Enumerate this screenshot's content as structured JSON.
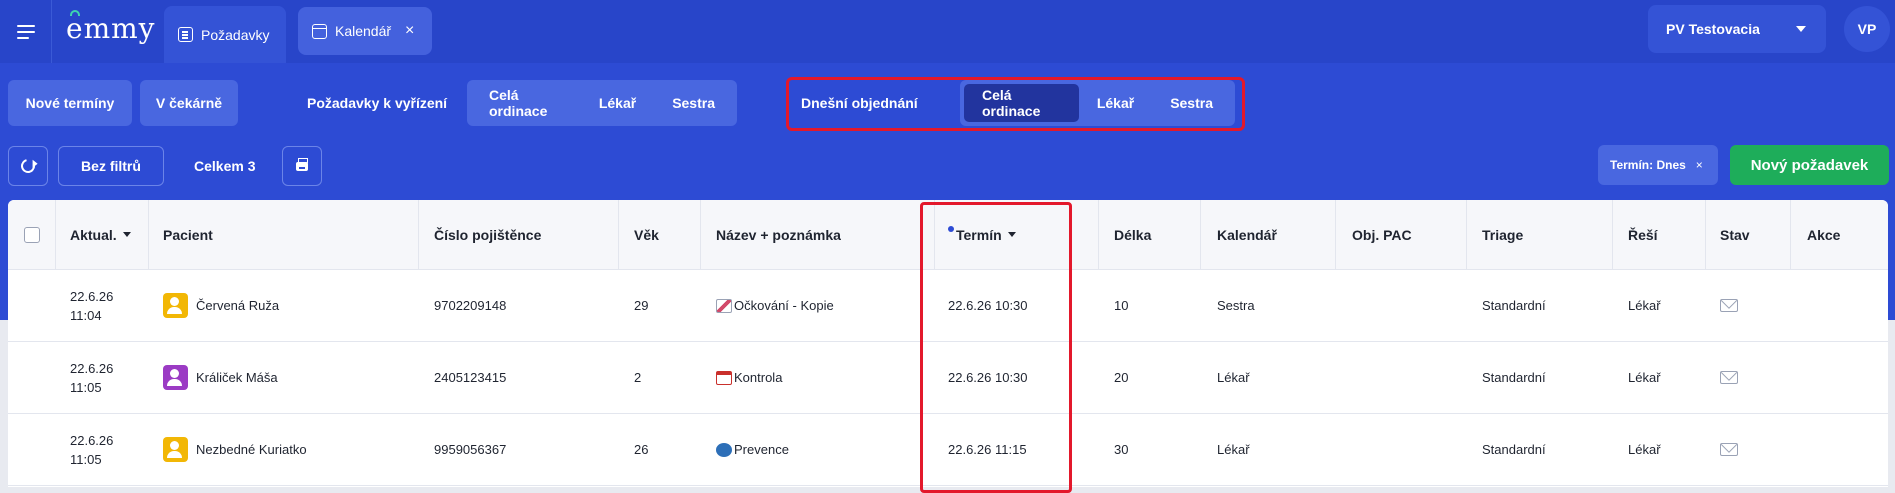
{
  "app": {
    "logo": "emmy"
  },
  "tabs": [
    {
      "label": "Požadavky",
      "icon": "document-icon",
      "active": true
    },
    {
      "label": "Kalendář",
      "icon": "calendar-icon",
      "closable": true,
      "close_glyph": "×"
    }
  ],
  "header": {
    "org_select": "PV Testovacia",
    "user_initials": "VP"
  },
  "toolbar": {
    "new_terms": "Nové termíny",
    "waiting_room": "V čekárně",
    "pending_label": "Požadavky k vyřízení",
    "pending_segments": [
      "Celá ordinace",
      "Lékař",
      "Sestra"
    ],
    "today_label": "Dnešní objednání",
    "today_segments": [
      "Celá ordinace",
      "Lékař",
      "Sestra"
    ],
    "today_active": "Celá ordinace",
    "no_filters": "Bez filtrů",
    "total": "Celkem 3",
    "filter_chip": "Termín: Dnes",
    "filter_chip_close": "×",
    "new_request": "Nový požadavek"
  },
  "table": {
    "columns": [
      "Aktual.",
      "Pacient",
      "Číslo pojištěnce",
      "Věk",
      "Název + poznámka",
      "Termín",
      "Délka",
      "Kalendář",
      "Obj. PAC",
      "Triage",
      "Řeší",
      "Stav",
      "Akce"
    ],
    "rows": [
      {
        "updated_date": "22.6.26",
        "updated_time": "11:04",
        "patient": "Červená Ruža",
        "patient_color": "#f2b705",
        "insurance": "9702209148",
        "age": "29",
        "note": "Očkování - Kopie",
        "note_icon": "vaccine-icon",
        "term": "22.6.26 10:30",
        "duration": "10",
        "calendar": "Sestra",
        "obj_pac": "",
        "triage": "Standardní",
        "handler": "Lékař",
        "status_icon": "envelope-icon"
      },
      {
        "updated_date": "22.6.26",
        "updated_time": "11:05",
        "patient": "Králiček Máša",
        "patient_color": "#9b3bc4",
        "insurance": "2405123415",
        "age": "2",
        "note": "Kontrola",
        "note_icon": "calendar-icon",
        "term": "22.6.26 10:30",
        "duration": "20",
        "calendar": "Lékař",
        "obj_pac": "",
        "triage": "Standardní",
        "handler": "Lékař",
        "status_icon": "envelope-icon"
      },
      {
        "updated_date": "22.6.26",
        "updated_time": "11:05",
        "patient": "Nezbedné Kuriatko",
        "patient_color": "#f2b705",
        "insurance": "9959056367",
        "age": "26",
        "note": "Prevence",
        "note_icon": "stethoscope-icon",
        "term": "22.6.26 11:15",
        "duration": "30",
        "calendar": "Lékař",
        "obj_pac": "",
        "triage": "Standardní",
        "handler": "Lékař",
        "status_icon": "envelope-icon"
      }
    ]
  },
  "colors": {
    "header": "#2845c9",
    "toolbar": "#2d4bd4",
    "segment": "#4967e0",
    "segment_active": "#22349e",
    "highlight": "#e3182b",
    "primary_action": "#1ead5a"
  }
}
